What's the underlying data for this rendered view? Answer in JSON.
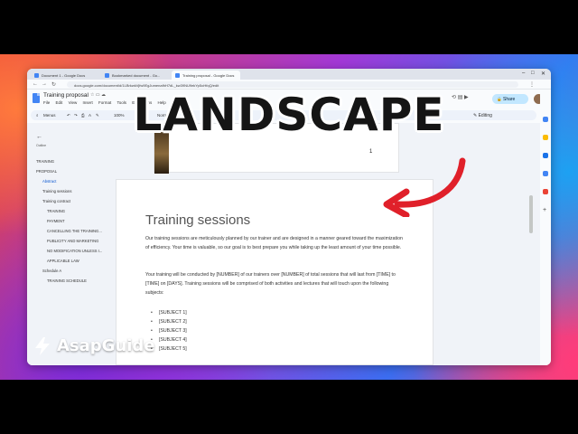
{
  "browser": {
    "tabs": [
      {
        "label": "Document 1 - Google Docs"
      },
      {
        "label": "Bookmarked document - Go..."
      },
      {
        "label": "Training proposal - Google Docs"
      }
    ],
    "url": "docs.google.com/document/d/1LBrkwkVjfw9EgJumenafhH7dL_kw39NU9ekYp5oHfqQ/edit"
  },
  "doc": {
    "title": "Training proposal",
    "menu": [
      "File",
      "Edit",
      "View",
      "Insert",
      "Format",
      "Tools",
      "Extensions",
      "Help"
    ],
    "share_label": "Share",
    "editing_label": "Editing",
    "toolbar": {
      "menus_label": "Menus",
      "zoom": "100%",
      "style": "Normal text"
    },
    "page_number": "1"
  },
  "outline": {
    "label": "Outline",
    "items": [
      {
        "label": "TRAINING",
        "level": 0
      },
      {
        "label": "PROPOSAL",
        "level": 0
      },
      {
        "label": "Abstract",
        "level": 1,
        "active": true
      },
      {
        "label": "Training sessions",
        "level": 1
      },
      {
        "label": "Training contract",
        "level": 1
      },
      {
        "label": "TRAINING",
        "level": 2
      },
      {
        "label": "PAYMENT",
        "level": 2
      },
      {
        "label": "CANCELLING THE TRAINING...",
        "level": 2
      },
      {
        "label": "PUBLICITY AND MARKETING",
        "level": 2
      },
      {
        "label": "NO MODIFICATION UNLESS I...",
        "level": 2
      },
      {
        "label": "APPLICABLE LAW",
        "level": 2
      },
      {
        "label": "Schedule A",
        "level": 0
      },
      {
        "label": "TRAINING SCHEDULE",
        "level": 1
      }
    ]
  },
  "page": {
    "heading": "Training sessions",
    "para1": "Our training sessions are meticulously planned by our trainer and are designed in a manner geared toward the maximization of efficiency. Your time is valuable, so our goal is to best prepare you while taking up the least amount of your time possible.",
    "para2": "Your training will be conducted by [NUMBER] of our trainers over [NUMBER] of total sessions that will last from [TIME] to [TIME] on [DAYS]. Training sessions will be comprised of both activities and lectures that will touch upon the following subjects:",
    "bullets": [
      "[SUBJECT 1]",
      "[SUBJECT 2]",
      "[SUBJECT 3]",
      "[SUBJECT 4]",
      "[SUBJECT 5]"
    ]
  },
  "overlay": {
    "headline": "LANDSCAPE",
    "brand": "AsapGuide",
    "arrow_color": "#e0202a"
  }
}
